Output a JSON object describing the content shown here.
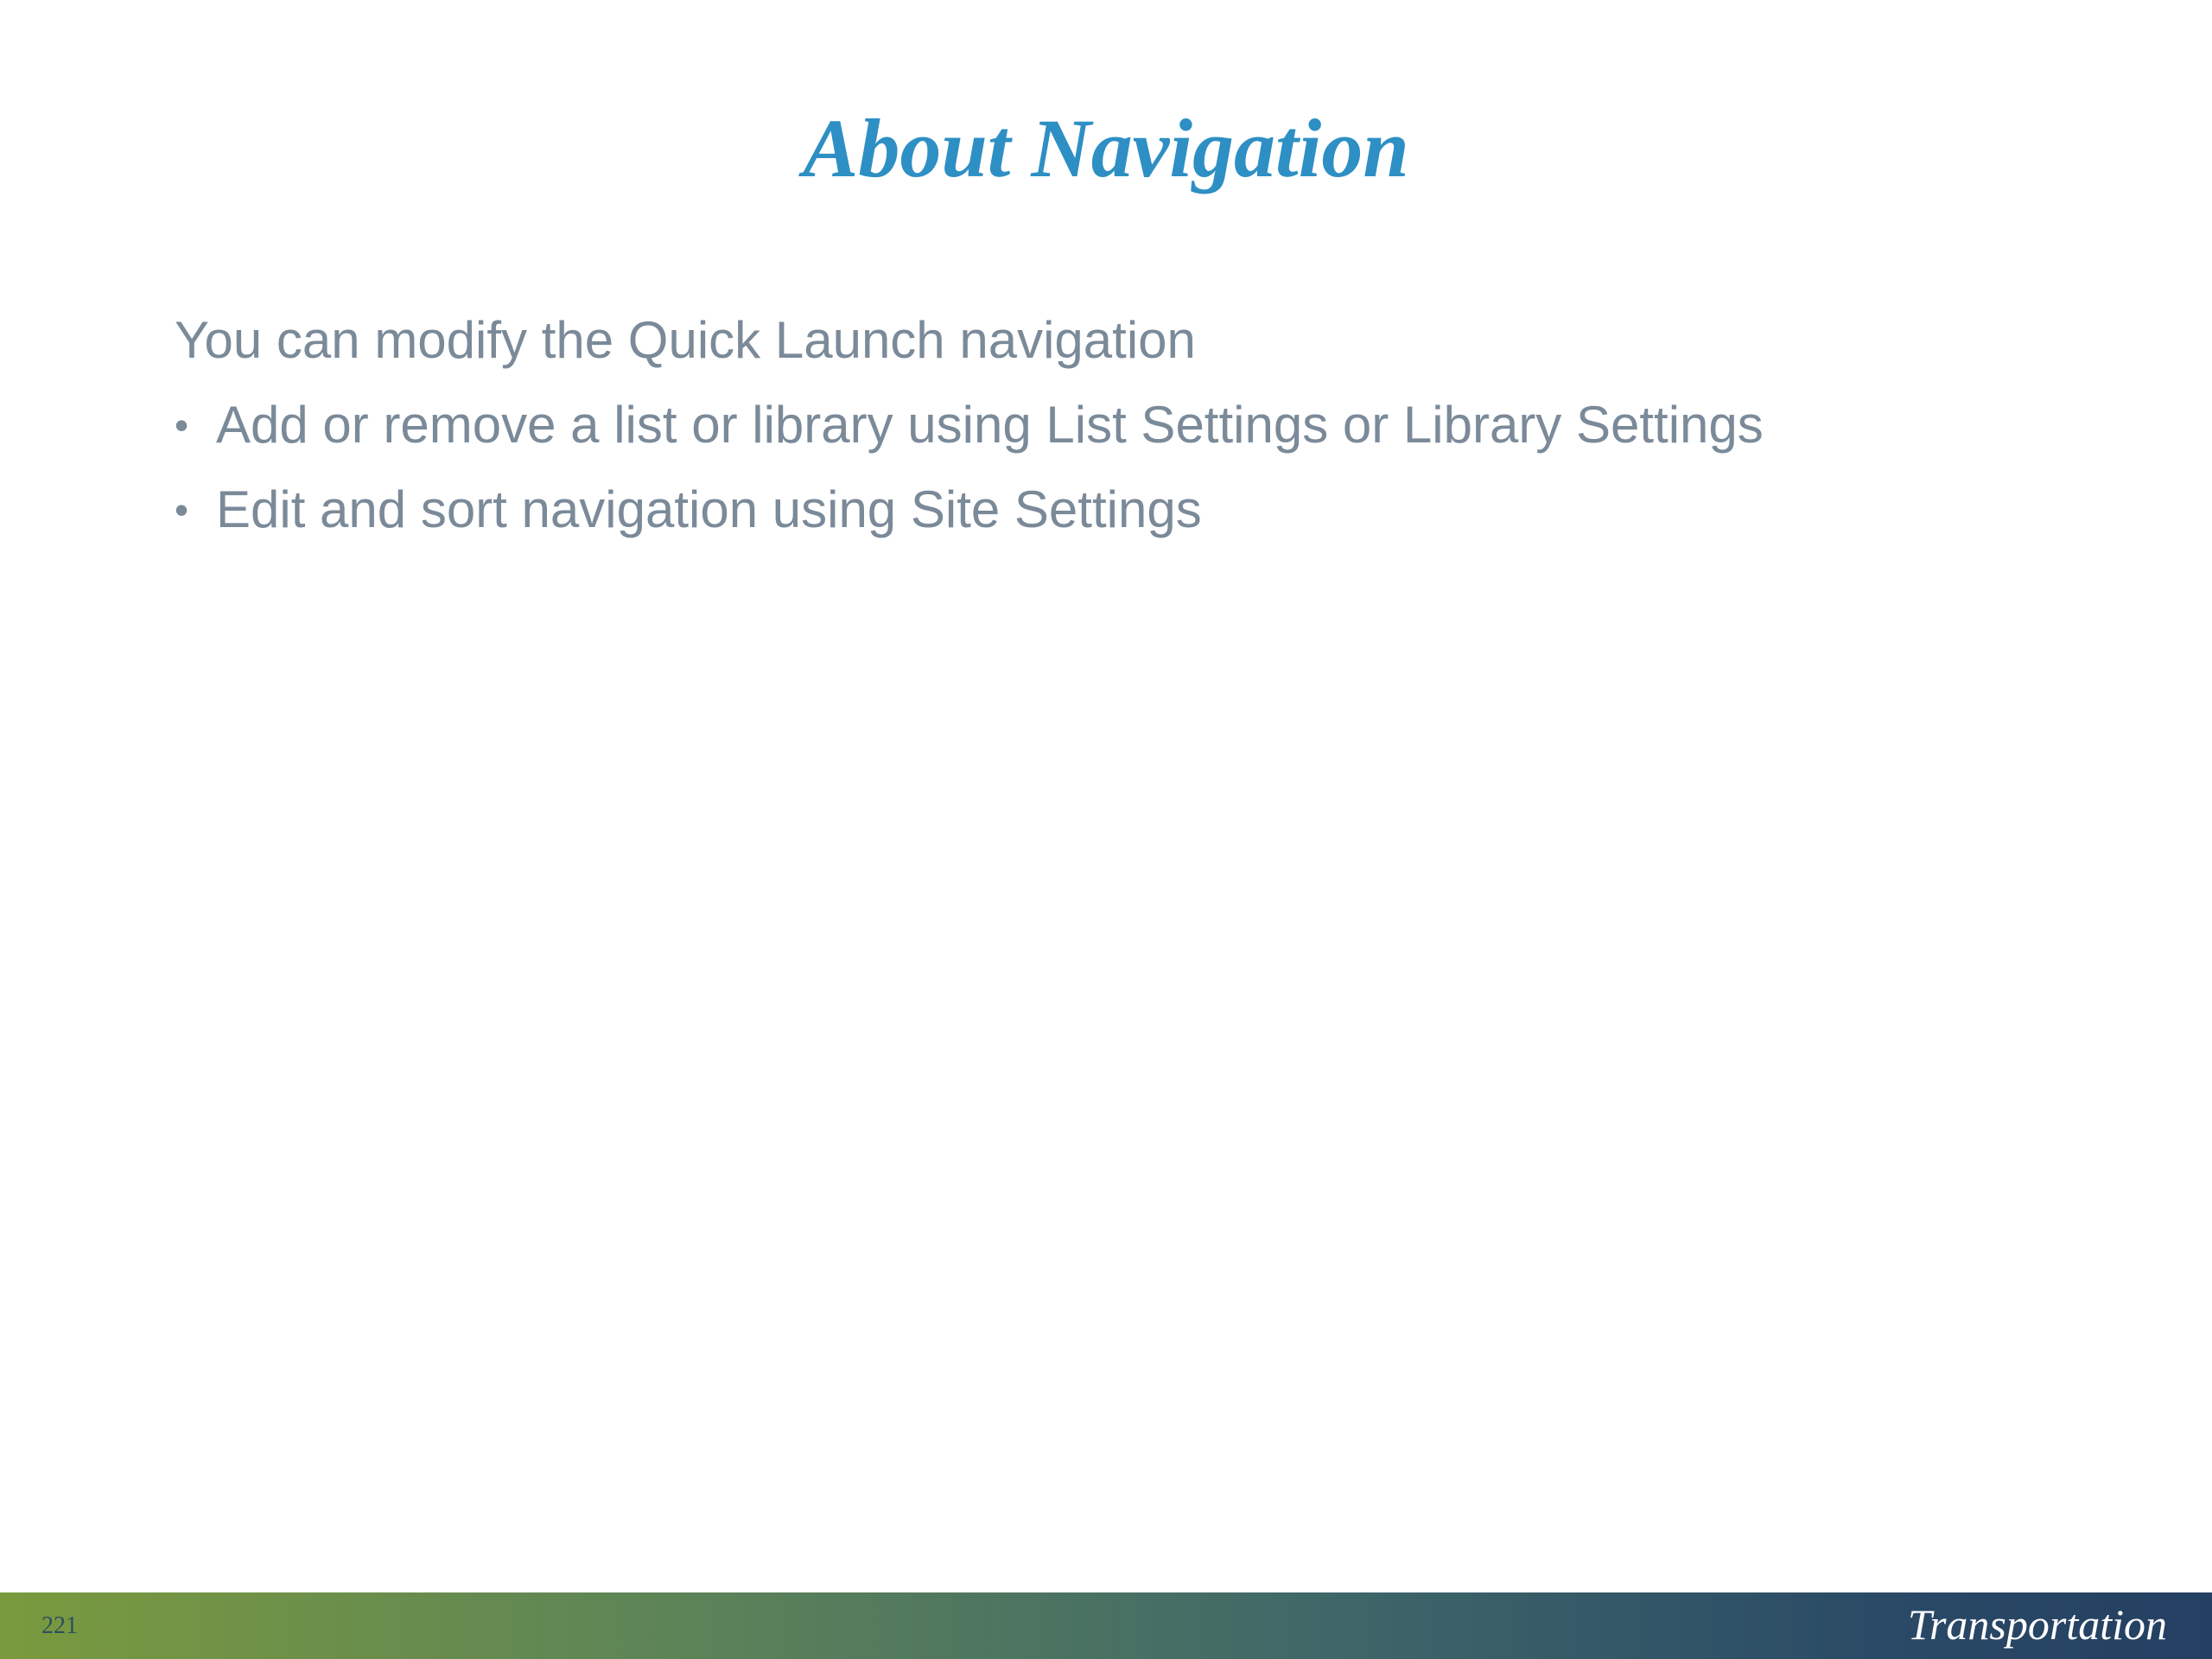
{
  "slide": {
    "title": "About Navigation",
    "intro": "You can modify the Quick Launch navigation",
    "bullets": [
      "Add or remove a list or library using List Settings or Library Settings",
      "Edit and sort navigation using Site Settings"
    ],
    "bullet_glyph": "•"
  },
  "footer": {
    "page_number": "221",
    "brand": "Transportation"
  },
  "colors": {
    "title": "#2e8fc4",
    "body_text": "#7b8a99",
    "footer_start": "#7a9a3e",
    "footer_end": "#243f62"
  }
}
